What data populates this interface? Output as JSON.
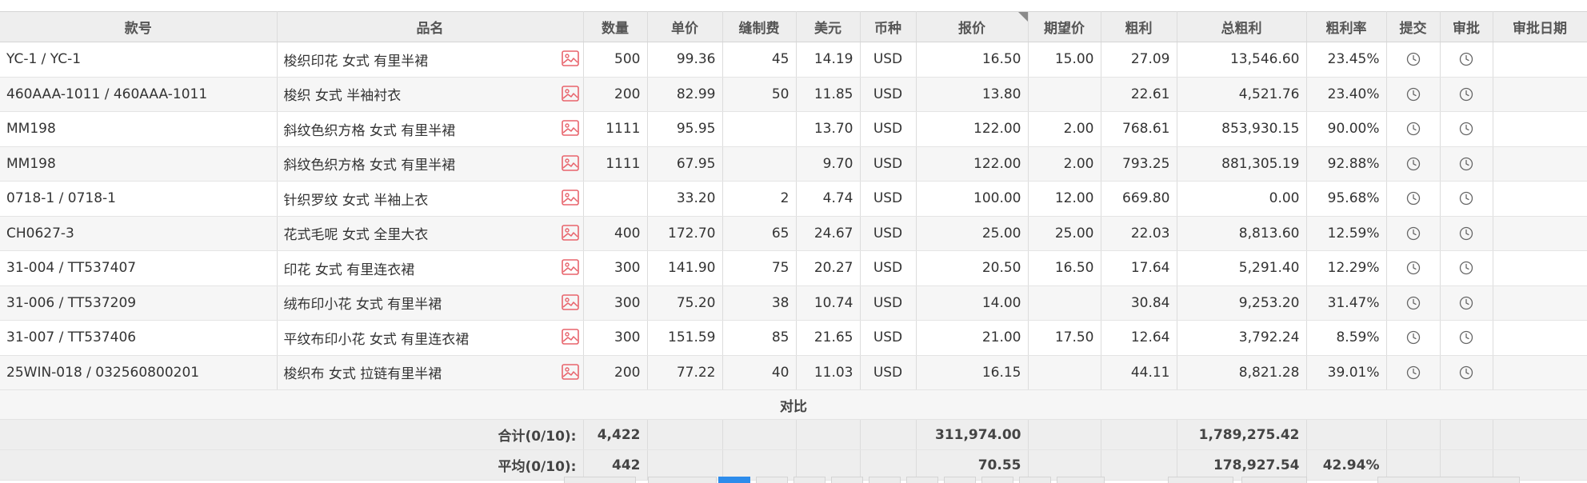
{
  "columns": [
    "款号",
    "品名",
    "数量",
    "单价",
    "缝制费",
    "美元",
    "币种",
    "报价",
    "期望价",
    "粗利",
    "总粗利",
    "粗利率",
    "提交",
    "审批",
    "审批日期"
  ],
  "colors": {
    "image_icon": "#e8646c",
    "clock_icon": "#666666",
    "pager_active": "#2d8ceb"
  },
  "icons": {
    "image": "image-icon",
    "clock": "clock-icon",
    "sort": "sort-corner-icon"
  },
  "rows": [
    {
      "code": "YC-1 / YC-1",
      "name": "梭织印花 女式 有里半裙",
      "qty": "500",
      "unit_price": "99.36",
      "sewing_fee": "45",
      "usd": "14.19",
      "currency": "USD",
      "quote": "16.50",
      "expected": "15.00",
      "gross": "27.09",
      "total_gross": "13,546.60",
      "rate": "23.45%"
    },
    {
      "code": "460AAA-1011 / 460AAA-1011",
      "name": "梭织 女式 半袖衬衣",
      "qty": "200",
      "unit_price": "82.99",
      "sewing_fee": "50",
      "usd": "11.85",
      "currency": "USD",
      "quote": "13.80",
      "expected": "",
      "gross": "22.61",
      "total_gross": "4,521.76",
      "rate": "23.40%"
    },
    {
      "code": "MM198",
      "name": "斜纹色织方格 女式 有里半裙",
      "qty": "1111",
      "unit_price": "95.95",
      "sewing_fee": "",
      "usd": "13.70",
      "currency": "USD",
      "quote": "122.00",
      "expected": "2.00",
      "gross": "768.61",
      "total_gross": "853,930.15",
      "rate": "90.00%"
    },
    {
      "code": "MM198",
      "name": "斜纹色织方格 女式 有里半裙",
      "qty": "1111",
      "unit_price": "67.95",
      "sewing_fee": "",
      "usd": "9.70",
      "currency": "USD",
      "quote": "122.00",
      "expected": "2.00",
      "gross": "793.25",
      "total_gross": "881,305.19",
      "rate": "92.88%"
    },
    {
      "code": "0718-1 / 0718-1",
      "name": "针织罗纹 女式 半袖上衣",
      "qty": "",
      "unit_price": "33.20",
      "sewing_fee": "2",
      "usd": "4.74",
      "currency": "USD",
      "quote": "100.00",
      "expected": "12.00",
      "gross": "669.80",
      "total_gross": "0.00",
      "rate": "95.68%"
    },
    {
      "code": "CH0627-3",
      "name": "花式毛呢 女式 全里大衣",
      "qty": "400",
      "unit_price": "172.70",
      "sewing_fee": "65",
      "usd": "24.67",
      "currency": "USD",
      "quote": "25.00",
      "expected": "25.00",
      "gross": "22.03",
      "total_gross": "8,813.60",
      "rate": "12.59%"
    },
    {
      "code": "31-004 / TT537407",
      "name": "印花 女式 有里连衣裙",
      "qty": "300",
      "unit_price": "141.90",
      "sewing_fee": "75",
      "usd": "20.27",
      "currency": "USD",
      "quote": "20.50",
      "expected": "16.50",
      "gross": "17.64",
      "total_gross": "5,291.40",
      "rate": "12.29%"
    },
    {
      "code": "31-006 / TT537209",
      "name": "绒布印小花 女式 有里半裙",
      "qty": "300",
      "unit_price": "75.20",
      "sewing_fee": "38",
      "usd": "10.74",
      "currency": "USD",
      "quote": "14.00",
      "expected": "",
      "gross": "30.84",
      "total_gross": "9,253.20",
      "rate": "31.47%"
    },
    {
      "code": "31-007 / TT537406",
      "name": "平纹布印小花 女式 有里连衣裙",
      "qty": "300",
      "unit_price": "151.59",
      "sewing_fee": "85",
      "usd": "21.65",
      "currency": "USD",
      "quote": "21.00",
      "expected": "17.50",
      "gross": "12.64",
      "total_gross": "3,792.24",
      "rate": "8.59%"
    },
    {
      "code": "25WIN-018 / 032560800201",
      "name": "梭织布 女式 拉链有里半裙",
      "qty": "200",
      "unit_price": "77.22",
      "sewing_fee": "40",
      "usd": "11.03",
      "currency": "USD",
      "quote": "16.15",
      "expected": "",
      "gross": "44.11",
      "total_gross": "8,821.28",
      "rate": "39.01%"
    }
  ],
  "compare_label": "对比",
  "summary": {
    "total_label": "合计(0/10):",
    "total_qty": "4,422",
    "total_quote": "311,974.00",
    "total_gross": "1,789,275.42",
    "avg_label": "平均(0/10):",
    "avg_qty": "442",
    "avg_quote": "70.55",
    "avg_gross": "178,927.54",
    "avg_rate": "42.94%"
  }
}
